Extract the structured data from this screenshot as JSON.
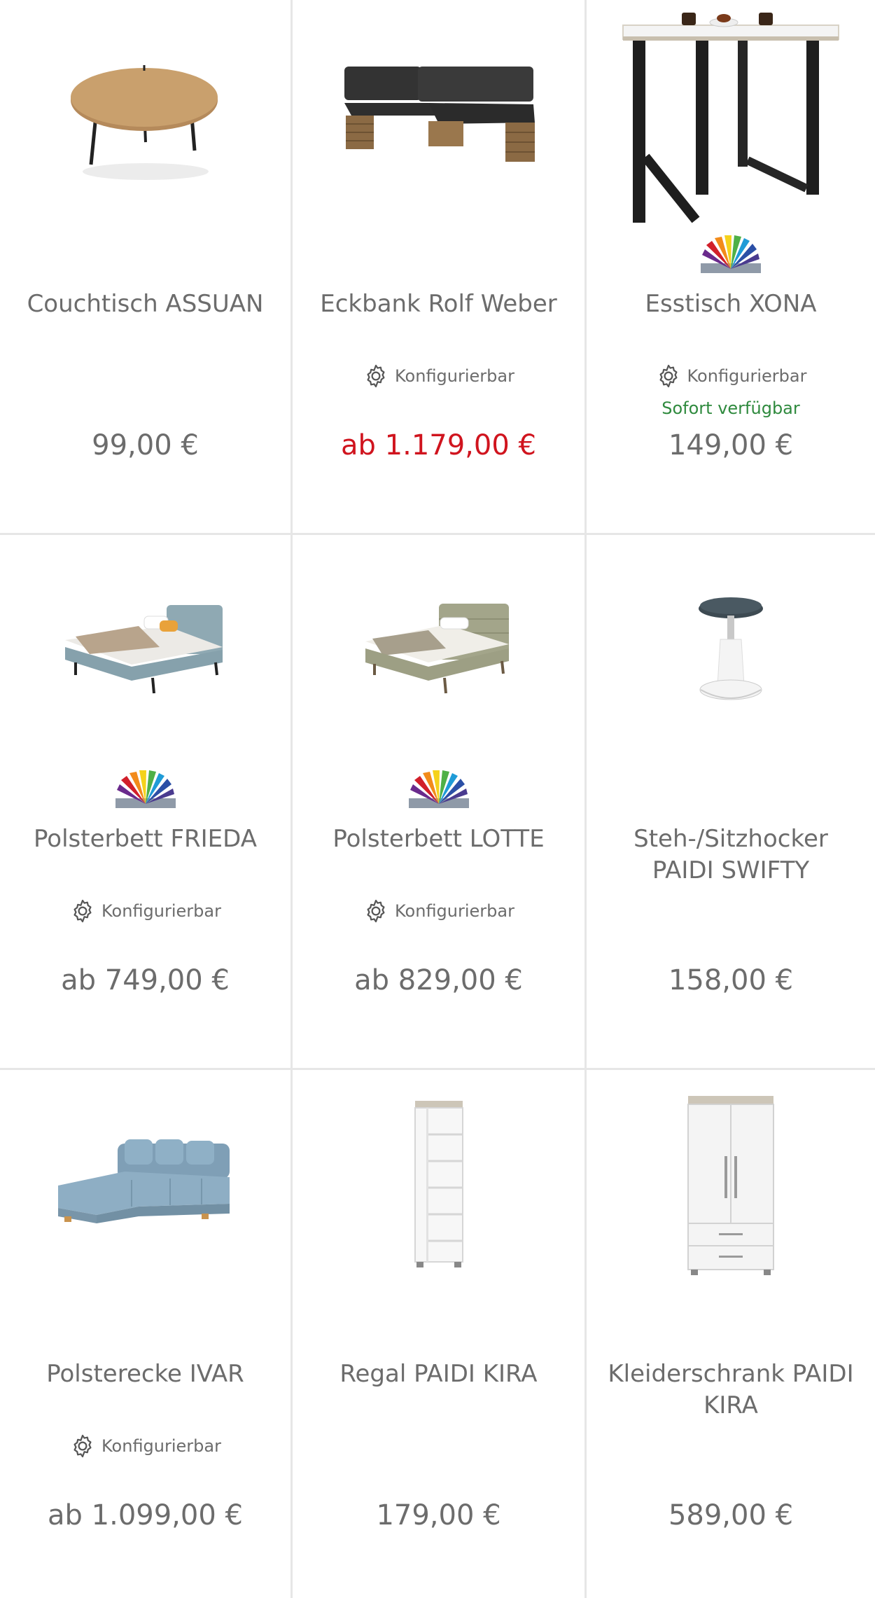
{
  "products": [
    {
      "name": "Couchtisch ASSUAN",
      "configurable": false,
      "availability": "",
      "price": "99,00 €",
      "price_color": "#6c6c6c",
      "color_swatch": false,
      "icon": "coffee-table"
    },
    {
      "name": "Eckbank Rolf Weber",
      "configurable": true,
      "config_label": "Konfigurierbar",
      "availability": "",
      "price": "ab 1.179,00 €",
      "price_color": "#d0141e",
      "color_swatch": false,
      "icon": "corner-bench"
    },
    {
      "name": "Esstisch XONA",
      "configurable": true,
      "config_label": "Konfigurierbar",
      "availability": "Sofort verfügbar",
      "price": "149,00 €",
      "price_color": "#6c6c6c",
      "color_swatch": true,
      "icon": "dining-table"
    },
    {
      "name": "Polsterbett FRIEDA",
      "configurable": true,
      "config_label": "Konfigurierbar",
      "availability": "",
      "price": "ab 749,00 €",
      "price_color": "#6c6c6c",
      "color_swatch": true,
      "icon": "bed"
    },
    {
      "name": "Polsterbett LOTTE",
      "configurable": true,
      "config_label": "Konfigurierbar",
      "availability": "",
      "price": "ab 829,00 €",
      "price_color": "#6c6c6c",
      "color_swatch": true,
      "icon": "bed"
    },
    {
      "name": "Steh-/Sitzhocker PAIDI SWIFTY",
      "configurable": false,
      "availability": "",
      "price": "158,00 €",
      "price_color": "#6c6c6c",
      "color_swatch": false,
      "icon": "stool"
    },
    {
      "name": "Polsterecke IVAR",
      "configurable": true,
      "config_label": "Konfigurierbar",
      "availability": "",
      "price": "ab 1.099,00 €",
      "price_color": "#6c6c6c",
      "color_swatch": false,
      "icon": "sofa"
    },
    {
      "name": "Regal PAIDI KIRA",
      "configurable": false,
      "availability": "",
      "price": "179,00 €",
      "price_color": "#6c6c6c",
      "color_swatch": false,
      "icon": "shelf"
    },
    {
      "name": "Kleiderschrank PAIDI KIRA",
      "configurable": false,
      "availability": "",
      "price": "589,00 €",
      "price_color": "#6c6c6c",
      "color_swatch": false,
      "icon": "wardrobe"
    }
  ],
  "colors": {
    "text": "#6c6c6c",
    "sale": "#d0141e",
    "available": "#2f8a3e",
    "divider": "#e6e6e6"
  }
}
